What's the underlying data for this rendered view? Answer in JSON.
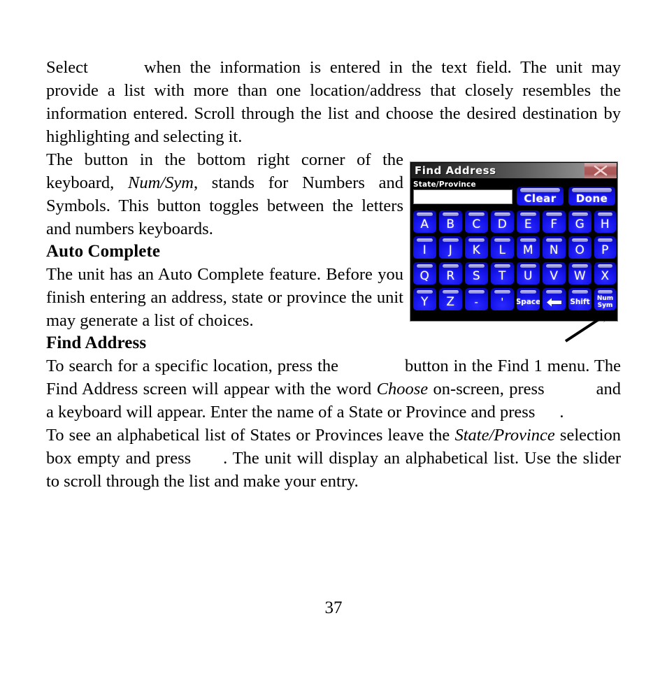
{
  "page": {
    "number": "37",
    "paragraphs": [
      {
        "id": "p1",
        "segments": [
          {
            "type": "text",
            "value": "Select"
          },
          {
            "type": "blank",
            "value": ""
          },
          {
            "type": "text",
            "value": "when the information is entered in the text field. The unit may provide a list with more than one location/address that closely resembles the information entered. Scroll through the list and choose the desired destination by highlighting and selecting it."
          }
        ]
      },
      {
        "id": "p2",
        "segments": [
          {
            "type": "text",
            "value": "The button in the bottom right corner of the keyboard, "
          },
          {
            "type": "italic",
            "value": "Num/Sym"
          },
          {
            "type": "text",
            "value": ", stands for Numbers and Symbols. This button toggles between the letters and numbers keyboards."
          }
        ]
      },
      {
        "id": "p3",
        "segments": [
          {
            "type": "text",
            "value": "The unit has an Auto Complete feature. Before you finish entering an address, state or province the unit may generate a list of choices."
          }
        ]
      },
      {
        "id": "p4",
        "segments": [
          {
            "type": "text",
            "value": "To search for a specific location, press the"
          },
          {
            "type": "blank",
            "value": ""
          },
          {
            "type": "text",
            "value": "button in the Find 1 menu. The Find Address screen will appear with the word "
          },
          {
            "type": "italic",
            "value": "Choose"
          },
          {
            "type": "text",
            "value": " on-screen, press"
          },
          {
            "type": "blank",
            "value": ""
          },
          {
            "type": "text",
            "value": "and a keyboard will appear. Enter the name of a State or Province and press"
          },
          {
            "type": "blank",
            "value": ""
          },
          {
            "type": "text",
            "value": "."
          }
        ]
      },
      {
        "id": "p5",
        "segments": [
          {
            "type": "text",
            "value": "To see an alphabetical list of States or Provinces leave the "
          },
          {
            "type": "italic",
            "value": "State/Province"
          },
          {
            "type": "text",
            "value": " selection box empty and press"
          },
          {
            "type": "blank",
            "value": ""
          },
          {
            "type": "text",
            "value": ". The unit will display an alphabetical list. Use the slider to scroll through the list and make your entry."
          }
        ]
      }
    ],
    "headings": {
      "auto_complete": "Auto Complete",
      "find_address": "Find Address"
    }
  },
  "device": {
    "titlebar": {
      "title": "Find Address",
      "close_icon": "close-x-icon"
    },
    "field": {
      "label": "State/Province",
      "value": "",
      "placeholder": ""
    },
    "actions": [
      {
        "label": "Clear",
        "name": "clear-button"
      },
      {
        "label": "Done",
        "name": "done-button"
      }
    ],
    "keyboard": {
      "rows": [
        [
          {
            "label": "A",
            "kind": "letter"
          },
          {
            "label": "B",
            "kind": "letter"
          },
          {
            "label": "C",
            "kind": "letter"
          },
          {
            "label": "D",
            "kind": "letter"
          },
          {
            "label": "E",
            "kind": "letter"
          },
          {
            "label": "F",
            "kind": "letter"
          },
          {
            "label": "G",
            "kind": "letter"
          },
          {
            "label": "H",
            "kind": "letter"
          }
        ],
        [
          {
            "label": "I",
            "kind": "letter"
          },
          {
            "label": "J",
            "kind": "letter"
          },
          {
            "label": "K",
            "kind": "letter"
          },
          {
            "label": "L",
            "kind": "letter"
          },
          {
            "label": "M",
            "kind": "letter"
          },
          {
            "label": "N",
            "kind": "letter"
          },
          {
            "label": "O",
            "kind": "letter"
          },
          {
            "label": "P",
            "kind": "letter"
          }
        ],
        [
          {
            "label": "Q",
            "kind": "letter"
          },
          {
            "label": "R",
            "kind": "letter"
          },
          {
            "label": "S",
            "kind": "letter"
          },
          {
            "label": "T",
            "kind": "letter"
          },
          {
            "label": "U",
            "kind": "letter"
          },
          {
            "label": "V",
            "kind": "letter"
          },
          {
            "label": "W",
            "kind": "letter"
          },
          {
            "label": "X",
            "kind": "letter"
          }
        ],
        [
          {
            "label": "Y",
            "kind": "letter"
          },
          {
            "label": "Z",
            "kind": "letter"
          },
          {
            "label": "-",
            "kind": "symbol"
          },
          {
            "label": "'",
            "kind": "symbol"
          },
          {
            "label": "Space",
            "kind": "small"
          },
          {
            "label": "",
            "kind": "backspace",
            "icon": "backspace-arrow-icon"
          },
          {
            "label": "Shift",
            "kind": "small"
          },
          {
            "label": "Num\nSym",
            "kind": "tiny"
          }
        ]
      ]
    },
    "annotation": {
      "pointer_icon": "callout-arrow-icon"
    }
  },
  "colors": {
    "key_blue": "#1414ea",
    "key_highlight": "#9f9fe4",
    "close_red": "#b05c5c",
    "titlebar_dark": "#1c1c1c",
    "titlebar_light": "#8d8d8d",
    "input_bg": "#ffffff",
    "device_bg": "#000000",
    "page_bg": "#ffffff",
    "text": "#000000"
  }
}
